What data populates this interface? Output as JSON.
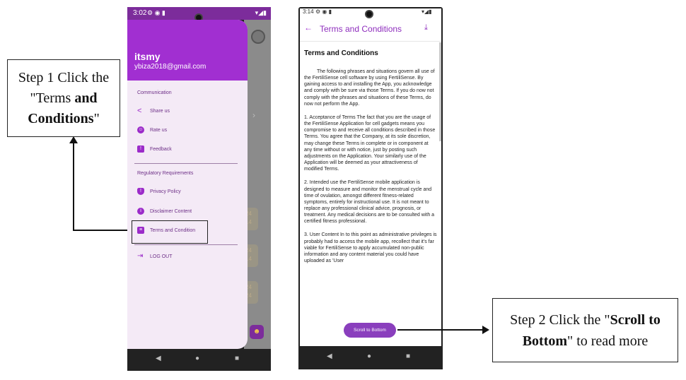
{
  "callouts": {
    "step1": {
      "pre": "Step 1 Click the \"Terms ",
      "bold1": "and",
      "bold2": "Conditions",
      "post": "\""
    },
    "step2": {
      "pre": "Step 2 Click the \"",
      "bold": "Scroll to Bottom",
      "post": "\" to read more"
    }
  },
  "phone1": {
    "status": {
      "time": "3:02",
      "icons": "⚙ ◉ ▮",
      "right": "▾◢▮"
    },
    "drawer": {
      "name": "itsmy",
      "email": "ybiza2018@gmail.com",
      "section1": "Communication",
      "items1": [
        "Share us",
        "Rate us",
        "Feedback"
      ],
      "section2": "Regulatory Requirements",
      "items2": [
        "Privacy Policy",
        "Disclaimer Content",
        "Terms and Condition"
      ],
      "logout": "LOG OUT"
    },
    "background_text": [
      "24",
      "14",
      "24",
      "14",
      "24",
      "24"
    ]
  },
  "phone2": {
    "status": {
      "time": "3:14",
      "icons": "⚙ ◉ ▮",
      "right": "▾◢▮"
    },
    "appbar_title": "Terms and Conditions",
    "heading": "Terms and Conditions",
    "paragraphs": [
      "The following phrases and situations govern all use of the FertiliSense cell software by using FertiliSense. By gaining access to and installing the App, you acknowledge and comply with be sure via those Terms. If you do now not comply with the phrases and situations of these Terms, do now not perform the App.",
      "1. Acceptance of Terms The fact that you are the usage of the FertiliSense Application for cell gadgets means you compromise to and receive all conditions described in those Terms. You agree that the Company, at its sole discretion, may change these Terms in complete or in component at any time without or with notice, just by posting such adjustments on the Application. Your similarly use of the Application will be deemed as your attractiveness of modified Terms.",
      "2. Intended use the FertiliSense mobile application is designed to measure and monitor the menstrual cycle and time of ovulation, amongst different fitness-related symptoms, entirely for instructional use. It is not meant to replace any professional clinical advice, prognosis, or treatment. Any medical decisions are to be consulted with a certified fitness professional.",
      "3. User Content In to this point as administrative privileges is probably had to access the mobile app, recollect that it's far viable for FertiliSense to apply accumulated non-public information and any content material you could have uploaded as 'User"
    ],
    "scroll_button": "Scroll to Bottom"
  },
  "nav": {
    "back": "◀",
    "home": "●",
    "recent": "■"
  },
  "colors": {
    "purple": "#a12fd1",
    "status": "#7c2c9b",
    "drawer_bg": "#f4eaf6",
    "button": "#8a3fbd"
  }
}
